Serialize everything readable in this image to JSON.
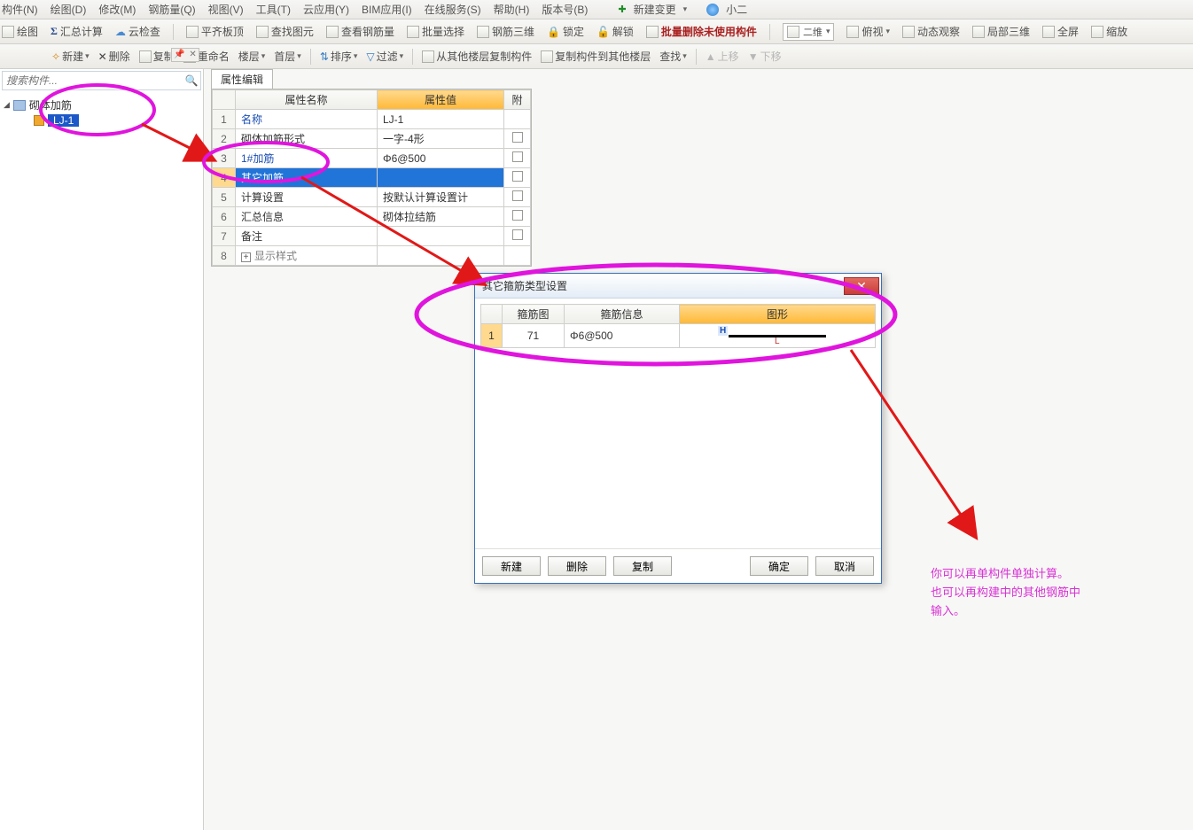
{
  "menu": {
    "items": [
      "构件(N)",
      "绘图(D)",
      "修改(M)",
      "钢筋量(Q)",
      "视图(V)",
      "工具(T)",
      "云应用(Y)",
      "BIM应用(I)",
      "在线服务(S)",
      "帮助(H)",
      "版本号(B)"
    ],
    "new_change": "新建变更",
    "user": "小二"
  },
  "toolbar1": {
    "draw": "绘图",
    "sigma": "汇总计算",
    "cloud": "云检查",
    "flat_top": "平齐板顶",
    "find_elem": "查找图元",
    "view_rebar": "查看钢筋量",
    "batch_select": "批量选择",
    "rebar_3d": "钢筋三维",
    "lock": "锁定",
    "unlock": "解锁",
    "batch_delete": "批量删除未使用构件",
    "combo_2d": "二维",
    "top_view": "俯视",
    "dyn_obs": "动态观察",
    "local_3d": "局部三维",
    "fullscreen": "全屏",
    "zoom": "缩放"
  },
  "toolbar2": {
    "new": "新建",
    "delete": "删除",
    "copy": "复制",
    "rename": "重命名",
    "floor_lbl": "楼层",
    "floor_val": "首层",
    "sort": "排序",
    "filter": "过滤",
    "copy_from": "从其他楼层复制构件",
    "copy_to": "复制构件到其他楼层",
    "find": "查找",
    "up": "上移",
    "down": "下移"
  },
  "sidebar": {
    "search_placeholder": "搜索构件...",
    "root": "砌体加筋",
    "child": "LJ-1"
  },
  "prop": {
    "tab": "属性编辑",
    "headers": {
      "name": "属性名称",
      "value": "属性值",
      "ext": "附"
    },
    "rows": [
      {
        "n": "1",
        "name": "名称",
        "value": "LJ-1",
        "link": true,
        "chk": false
      },
      {
        "n": "2",
        "name": "砌体加筋形式",
        "value": "一字-4形",
        "chk": true
      },
      {
        "n": "3",
        "name": "1#加筋",
        "value": "Φ6@500",
        "link": true,
        "chk": true
      },
      {
        "n": "4",
        "name": "其它加筋",
        "value": "",
        "sel": true,
        "chk": true
      },
      {
        "n": "5",
        "name": "计算设置",
        "value": "按默认计算设置计",
        "chk": true
      },
      {
        "n": "6",
        "name": "汇总信息",
        "value": "砌体拉结筋",
        "chk": true
      },
      {
        "n": "7",
        "name": "备注",
        "value": "",
        "chk": true
      },
      {
        "n": "8",
        "name": "显示样式",
        "value": "",
        "gray": true,
        "expand": true
      }
    ]
  },
  "dialog": {
    "title": "其它箍筋类型设置",
    "headers": {
      "img": "箍筋图",
      "info": "箍筋信息",
      "graphic": "图形"
    },
    "row": {
      "n": "1",
      "img": "71",
      "info": "Φ6@500",
      "H": "H",
      "L": "L"
    },
    "buttons": {
      "new": "新建",
      "delete": "删除",
      "copy": "复制",
      "ok": "确定",
      "cancel": "取消"
    }
  },
  "note": {
    "line1": "你可以再单构件单独计算。",
    "line2": "也可以再构建中的其他钢筋中",
    "line3": "输入。"
  }
}
